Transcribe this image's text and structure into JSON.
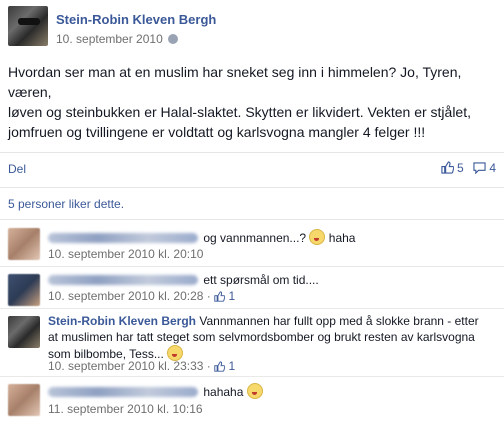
{
  "post": {
    "author": "Stein-Robin Kleven Bergh",
    "date": "10. september 2010",
    "body_lines": [
      "Hvordan ser man at en muslim har sneket seg inn i himmelen? Jo, Tyren,",
      "væren,",
      "løven og steinbukken er Halal-slaktet. Skytten er likvidert. Vekten er stjålet,",
      "jomfruen og tvillingene er voldtatt og karlsvogna mangler 4 felger !!!"
    ]
  },
  "actions": {
    "share_label": "Del",
    "like_count": "5",
    "comment_count": "4"
  },
  "likes_summary": "5 personer liker dette.",
  "comments": [
    {
      "text": "og vannmannen...?",
      "after_emoji": "haha",
      "meta": "10. september 2010 kl. 20:10",
      "likes": ""
    },
    {
      "text": "ett spørsmål om tid....",
      "after_emoji": "",
      "meta": "10. september 2010 kl. 20:28 · ",
      "likes": "1"
    },
    {
      "author": "Stein-Robin Kleven Bergh",
      "text": "Vannmannen har fullt opp med å slokke brann - etter at muslimen har tatt steget som selvmordsbomber og brukt resten av karlsvogna som bilbombe, Tess...",
      "meta": "10. september 2010 kl. 23:33 · ",
      "likes": "1"
    },
    {
      "text": "hahaha",
      "after_emoji": "",
      "meta": "11. september 2010 kl. 10:16",
      "likes": ""
    }
  ],
  "icons": {
    "privacy": "globe-icon",
    "like": "thumbs-up-icon",
    "comment": "comment-bubble-icon",
    "emoji": "smiley-icon"
  },
  "colors": {
    "link": "#3b5998",
    "meta": "#6f6f6f",
    "divider": "#e5e5e5"
  }
}
